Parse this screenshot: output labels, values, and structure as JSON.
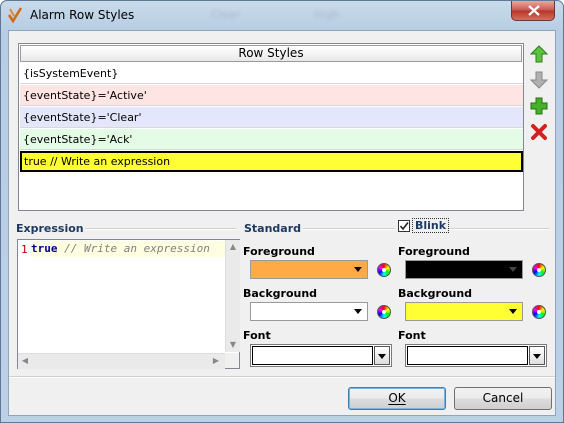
{
  "window": {
    "title": "Alarm Row Styles",
    "ghost_title_1": "Clear",
    "ghost_title_2": "High",
    "close_icon": "close-icon"
  },
  "row_styles": {
    "header": "Row Styles",
    "rows": [
      {
        "text": "{isSystemEvent}",
        "bg": "#ffffff"
      },
      {
        "text": "{eventState}='Active'",
        "bg": "#ffe4e4"
      },
      {
        "text": "{eventState}='Clear'",
        "bg": "#e4e7fb"
      },
      {
        "text": "{eventState}='Ack'",
        "bg": "#e4fbe6"
      },
      {
        "text": "true // Write an expression",
        "bg": "#ffff33"
      }
    ],
    "selected_index": 4,
    "side_buttons": [
      "move-up-icon",
      "move-down-icon",
      "add-icon",
      "delete-icon"
    ]
  },
  "expression": {
    "label": "Expression",
    "line_number": "1",
    "keyword": "true",
    "comment": " // Write an expression"
  },
  "standard": {
    "label": "Standard",
    "foreground_label": "Foreground",
    "foreground_color": "#ffaa44",
    "background_label": "Background",
    "background_color": "#ffffff",
    "font_label": "Font",
    "font_value": ""
  },
  "blink": {
    "label": "Blink",
    "checked": true,
    "foreground_label": "Foreground",
    "foreground_color": "#000000",
    "background_label": "Background",
    "background_color": "#ffff33",
    "font_label": "Font",
    "font_value": ""
  },
  "buttons": {
    "ok": "OK",
    "cancel": "Cancel"
  }
}
